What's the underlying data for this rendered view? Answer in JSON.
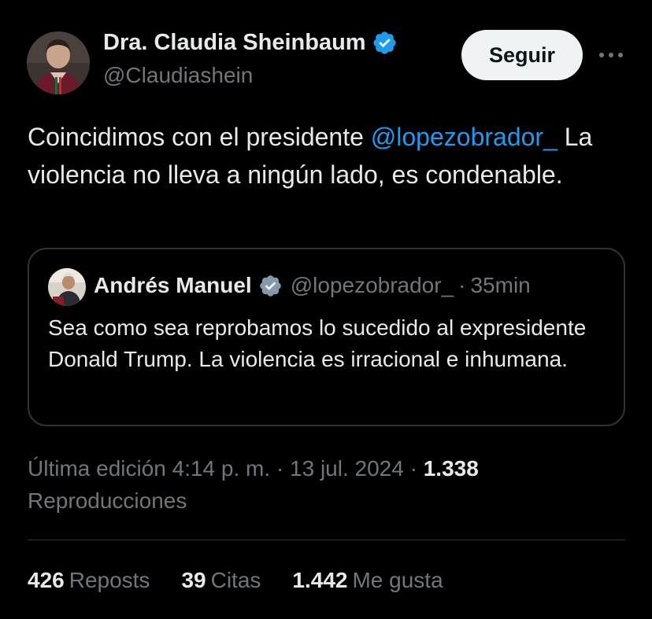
{
  "author": {
    "name": "Dra. Claudia Sheinbaum",
    "handle": "@Claudiashein",
    "verified_color": "#1d9bf0"
  },
  "follow_label": "Seguir",
  "more_icon": "more-horizontal-icon",
  "tweet": {
    "text_before": "Coincidimos con el presidente ",
    "mention": "@lopezobrador_",
    "text_after": " La violencia no lleva a ningún lado, es condenable."
  },
  "quote": {
    "name": "Andrés Manuel",
    "verified_color": "#829aab",
    "handle": "@lopezobrador_",
    "separator": "·",
    "time": "35min",
    "text": "Sea como sea reprobamos lo sucedido al expresidente Donald Trump. La violencia es irracional e inhumana."
  },
  "meta": {
    "edited_time": "Última edición 4:14 p. m.",
    "separator": "·",
    "date": "13 jul. 2024",
    "views_count": "1.338",
    "views_label": "Reproducciones"
  },
  "stats": [
    {
      "count": "426",
      "label": "Reposts"
    },
    {
      "count": "39",
      "label": "Citas"
    },
    {
      "count": "1.442",
      "label": "Me gusta"
    }
  ],
  "colors": {
    "background": "#000000",
    "text": "#e7e9ea",
    "secondary": "#71767b",
    "link": "#1d9bf0",
    "border": "#2f3336"
  }
}
